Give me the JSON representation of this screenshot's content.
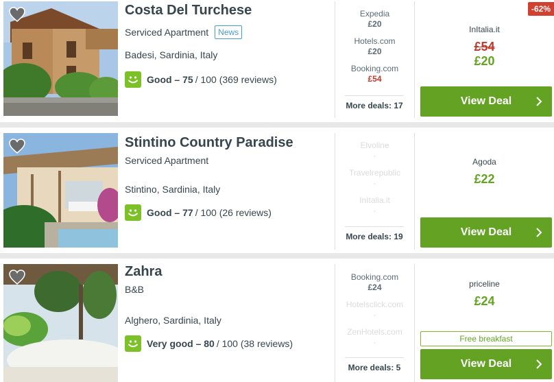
{
  "hotels": [
    {
      "name": "Costa Del Turchese",
      "type": "Serviced Apartment",
      "badge": "News",
      "location": "Badesi, Sardinia, Italy",
      "rating_label": "Good – 75",
      "rating_rest": "/ 100 (369 reviews)",
      "deals": [
        {
          "site": "Expedia",
          "price": "£20"
        },
        {
          "site": "Hotels.com",
          "price": "£20"
        },
        {
          "site": "Booking.com",
          "price": "£54"
        }
      ],
      "more_deals": "More deals: 17",
      "best_provider": "InItalia.it",
      "old_price": "£54",
      "best_price": "£20",
      "discount": "-62%",
      "button": "View Deal"
    },
    {
      "name": "Stintino Country Paradise",
      "type": "Serviced Apartment",
      "location": "Stintino, Sardinia, Italy",
      "rating_label": "Good – 77",
      "rating_rest": "/ 100 (26 reviews)",
      "deals": [
        {
          "site": "Elvoline",
          "price": "-"
        },
        {
          "site": "Travelrepublic",
          "price": "-"
        },
        {
          "site": "InItalia.it",
          "price": "-"
        }
      ],
      "more_deals": "More deals: 19",
      "best_provider": "Agoda",
      "best_price": "£22",
      "button": "View Deal"
    },
    {
      "name": "Zahra",
      "type": "B&B",
      "location": "Alghero, Sardinia, Italy",
      "rating_label": "Very good – 80",
      "rating_rest": "/ 100 (38 reviews)",
      "deals": [
        {
          "site": "Booking.com",
          "price": "£24"
        },
        {
          "site": "Hotelsclick.com",
          "price": "-"
        },
        {
          "site": "ZenHotels.com",
          "price": "-"
        }
      ],
      "more_deals": "More deals: 5",
      "best_provider": "priceline",
      "best_price": "£24",
      "perk": "Free breakfast",
      "button": "View Deal"
    }
  ],
  "colors": {
    "accent_green": "#63a223",
    "rating_green": "#7cc127",
    "discount_red": "#d0412f",
    "strike_red": "#c0392b",
    "badge_blue": "#4b9cc9"
  },
  "icons": [
    "heart-icon",
    "smiley-icon",
    "chevron-right-icon"
  ]
}
